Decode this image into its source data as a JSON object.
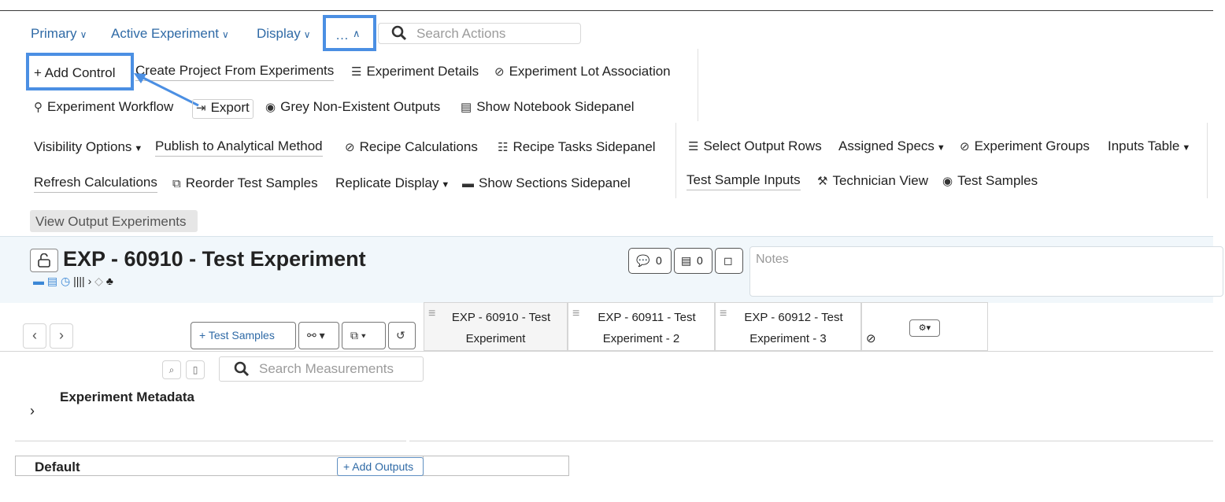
{
  "menu": {
    "primary": "Primary",
    "active_experiment": "Active Experiment",
    "display": "Display",
    "more": "…",
    "search_placeholder": "Search Actions"
  },
  "actions": {
    "add_control": "Add Control",
    "create_project": "Create Project From Experiments",
    "experiment_details": "Experiment Details",
    "experiment_lot": "Experiment Lot Association",
    "experiment_workflow": "Experiment Workflow",
    "export": "Export",
    "grey_outputs": "Grey Non-Existent Outputs",
    "show_notebook": "Show Notebook Sidepanel",
    "visibility_options": "Visibility Options",
    "publish_method": "Publish to Analytical Method",
    "recipe_calculations": "Recipe Calculations",
    "recipe_tasks": "Recipe Tasks Sidepanel",
    "select_output_rows": "Select Output Rows",
    "assigned_specs": "Assigned Specs",
    "experiment_groups": "Experiment Groups",
    "inputs_table": "Inputs Table",
    "refresh_calculations": "Refresh Calculations",
    "reorder_samples": "Reorder Test Samples",
    "replicate_display": "Replicate Display",
    "show_sections": "Show Sections Sidepanel",
    "test_sample_inputs": "Test Sample Inputs",
    "technician_view": "Technician View",
    "test_samples": "Test Samples",
    "view_output_experiments": "View Output Experiments"
  },
  "experiment": {
    "title": "EXP - 60910 - Test Experiment",
    "comments_count": "0",
    "notebook_count": "0",
    "notes_placeholder": "Notes"
  },
  "grid": {
    "test_samples_button": "+ Test Samples",
    "columns": [
      {
        "line1": "EXP - 60910 - Test",
        "line2": "Experiment"
      },
      {
        "line1": "EXP - 60911 - Test",
        "line2": "Experiment - 2"
      },
      {
        "line1": "EXP - 60912 - Test",
        "line2": "Experiment - 3"
      }
    ],
    "search_placeholder": "Search Measurements",
    "metadata_title": "Experiment Metadata",
    "default_label": "Default",
    "add_outputs": "+ Add Outputs"
  },
  "colors": {
    "link": "#2f6aa6",
    "highlight": "#4b8fe3",
    "band": "#f1f7fb"
  }
}
